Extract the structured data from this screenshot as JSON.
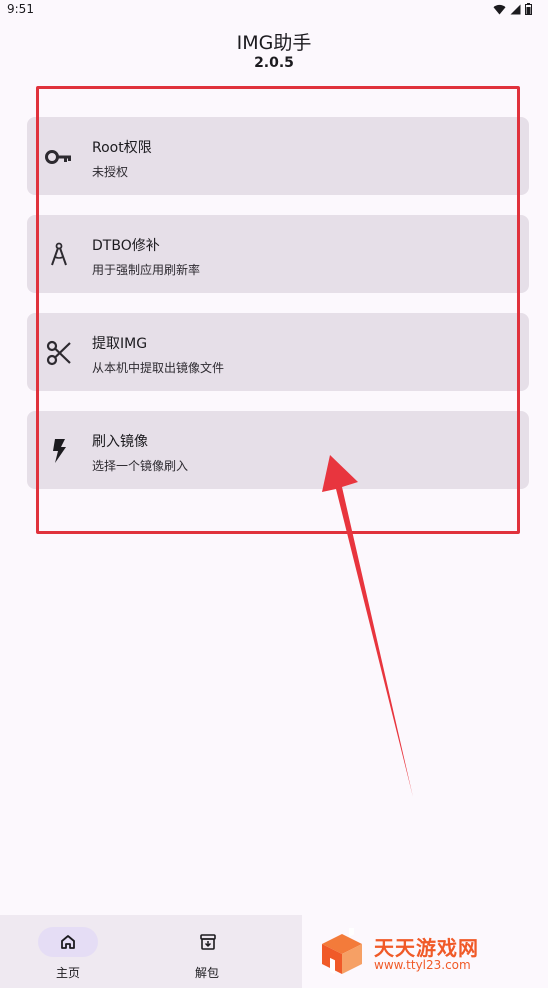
{
  "status_bar": {
    "time": "9:51",
    "icons": [
      "wifi-icon",
      "signal-icon",
      "battery-icon"
    ]
  },
  "header": {
    "title": "IMG助手",
    "version": "2.0.5"
  },
  "cards": [
    {
      "title": "Root权限",
      "subtitle": "未授权",
      "icon": "key-icon"
    },
    {
      "title": "DTBO修补",
      "subtitle": "用于强制应用刷新率",
      "icon": "compass-icon"
    },
    {
      "title": "提取IMG",
      "subtitle": "从本机中提取出镜像文件",
      "icon": "scissors-icon"
    },
    {
      "title": "刷入镜像",
      "subtitle": "选择一个镜像刷入",
      "icon": "flash-icon"
    }
  ],
  "bottom_nav": {
    "items": [
      {
        "label": "主页",
        "icon": "home-icon",
        "selected": true
      },
      {
        "label": "解包",
        "icon": "archive-download-icon",
        "selected": false
      }
    ]
  },
  "watermark": {
    "title": "天天游戏网",
    "url": "www.ttyl23.com"
  },
  "colors": {
    "background": "#fcf8fd",
    "card": "#e6dfe8",
    "annotation": "#e0323c",
    "nav_background": "#efe9f1",
    "nav_selected": "#e5ddf5",
    "watermark": "#f05a28"
  }
}
